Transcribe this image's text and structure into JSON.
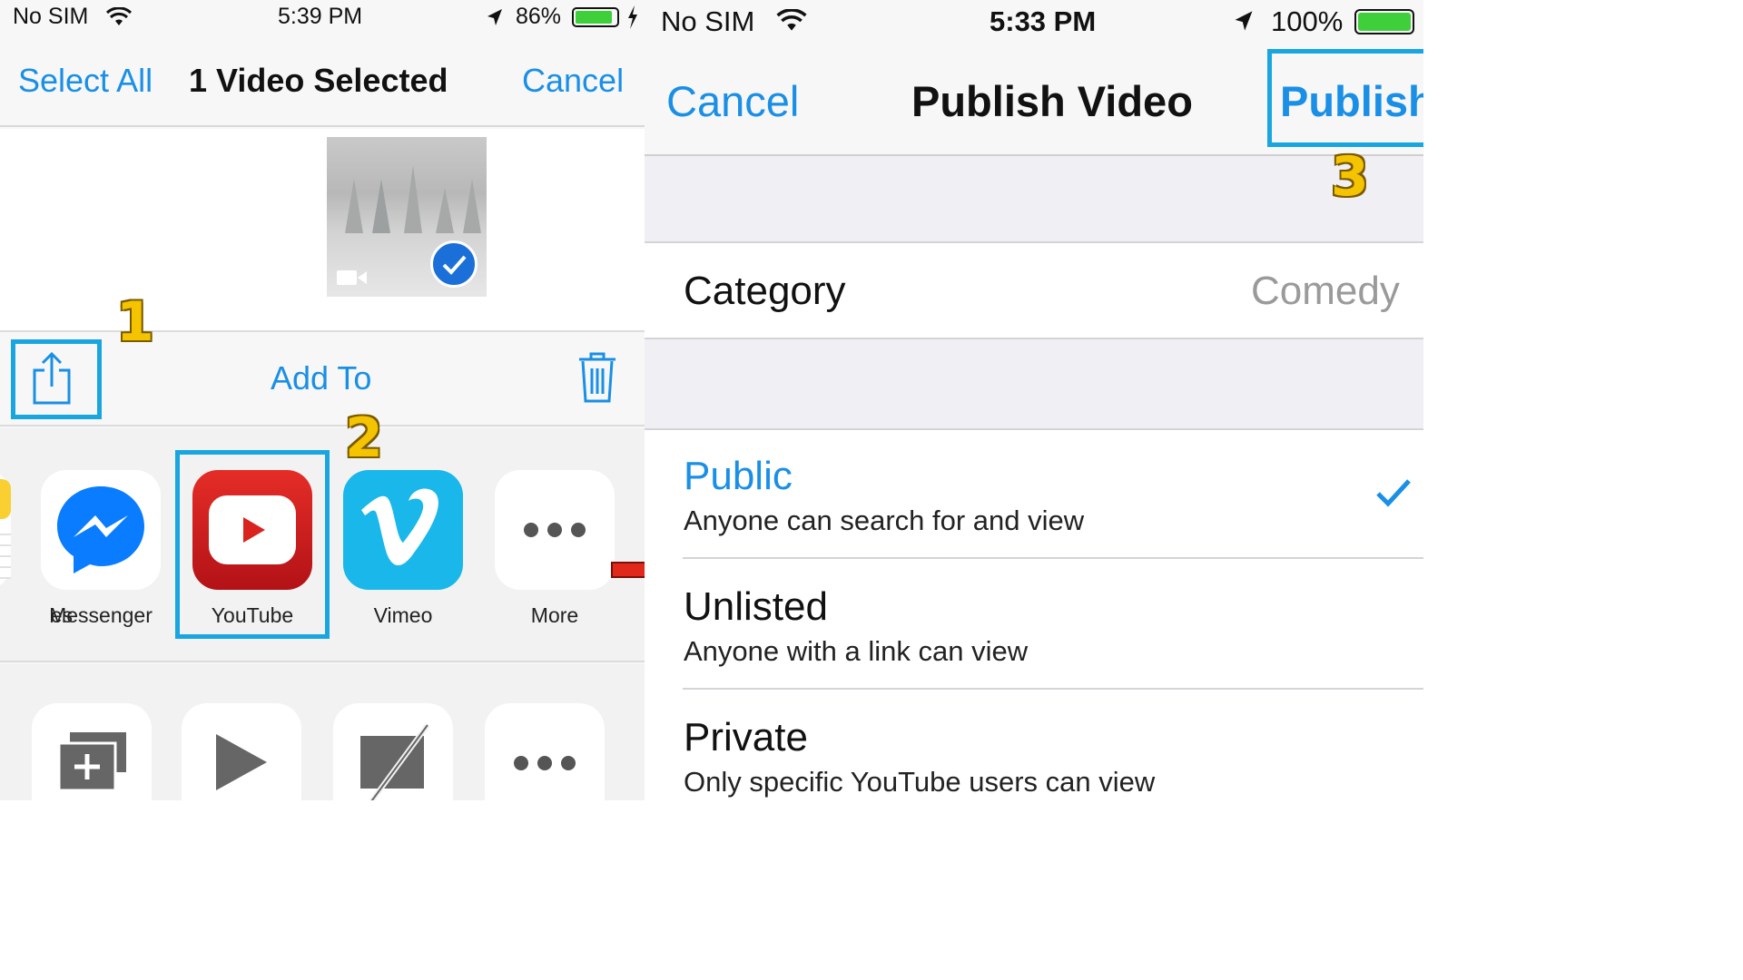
{
  "left_phone": {
    "status": {
      "carrier": "No SIM",
      "time": "5:39 PM",
      "battery": "86%"
    },
    "nav": {
      "select_all": "Select All",
      "title": "1 Video Selected",
      "cancel": "Cancel"
    },
    "toolbar": {
      "add_to": "Add To"
    },
    "share_apps": [
      {
        "label": "es",
        "icon": "notes-icon"
      },
      {
        "label": "Messenger",
        "icon": "messenger-icon"
      },
      {
        "label": "YouTube",
        "icon": "youtube-icon"
      },
      {
        "label": "Vimeo",
        "icon": "vimeo-icon"
      },
      {
        "label": "More",
        "icon": "more-icon"
      }
    ],
    "actions": [
      {
        "icon": "add-to-album-icon"
      },
      {
        "icon": "play-icon"
      },
      {
        "icon": "airplay-off-icon"
      },
      {
        "icon": "more-icon"
      }
    ]
  },
  "right_phone": {
    "status": {
      "carrier": "No SIM",
      "time": "5:33 PM",
      "battery": "100%"
    },
    "nav": {
      "cancel": "Cancel",
      "title": "Publish Video",
      "publish": "Publish"
    },
    "category": {
      "label": "Category",
      "value": "Comedy"
    },
    "privacy_options": [
      {
        "title": "Public",
        "subtitle": "Anyone can search for and view",
        "selected": true
      },
      {
        "title": "Unlisted",
        "subtitle": "Anyone with a link can view",
        "selected": false
      },
      {
        "title": "Private",
        "subtitle": "Only specific YouTube users can view",
        "selected": false
      }
    ]
  },
  "steps": [
    "1",
    "2",
    "3"
  ],
  "colors": {
    "ios_blue": "#1a8fe6",
    "highlight": "#19a6e0",
    "step_yellow": "#f5c400",
    "youtube_red": "#d9231f",
    "vimeo_blue": "#1ab7ea",
    "messenger_blue": "#0a7cff"
  }
}
